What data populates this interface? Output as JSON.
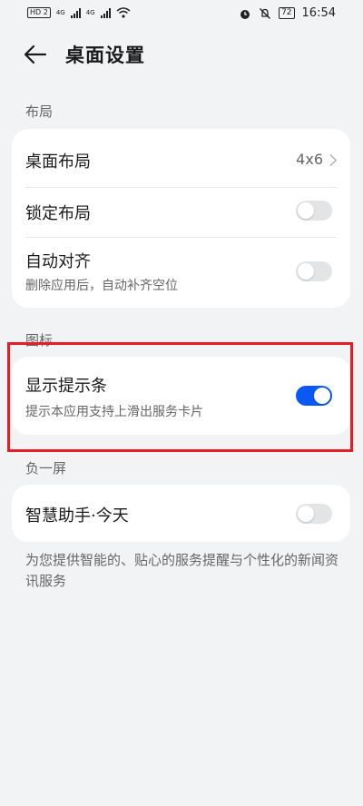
{
  "status_bar": {
    "hd_badge": "HD 2",
    "network_1": "4G",
    "network_2": "4G",
    "battery": "72",
    "time": "16:54"
  },
  "header": {
    "title": "桌面设置"
  },
  "sections": {
    "layout": {
      "label": "布局",
      "desktop_layout": {
        "label": "桌面布局",
        "value": "4x6"
      },
      "lock_layout": {
        "label": "锁定布局",
        "enabled": false
      },
      "auto_align": {
        "label": "自动对齐",
        "description": "删除应用后，自动补齐空位",
        "enabled": false
      }
    },
    "icons": {
      "label": "图标",
      "show_hint_bar": {
        "label": "显示提示条",
        "description": "提示本应用支持上滑出服务卡片",
        "enabled": true
      }
    },
    "minus_one_screen": {
      "label": "负一屏",
      "smart_assistant": {
        "label": "智慧助手·今天",
        "enabled": false
      },
      "footnote": "为您提供智能的、贴心的服务提醒与个性化的新闻资讯服务"
    }
  },
  "colors": {
    "accent": "#0a59f7",
    "highlight_box": "#e41d26"
  },
  "icons": [
    "back-arrow-icon",
    "chevron-right-icon",
    "wifi-icon",
    "alarm-icon",
    "mute-icon",
    "battery-icon"
  ]
}
